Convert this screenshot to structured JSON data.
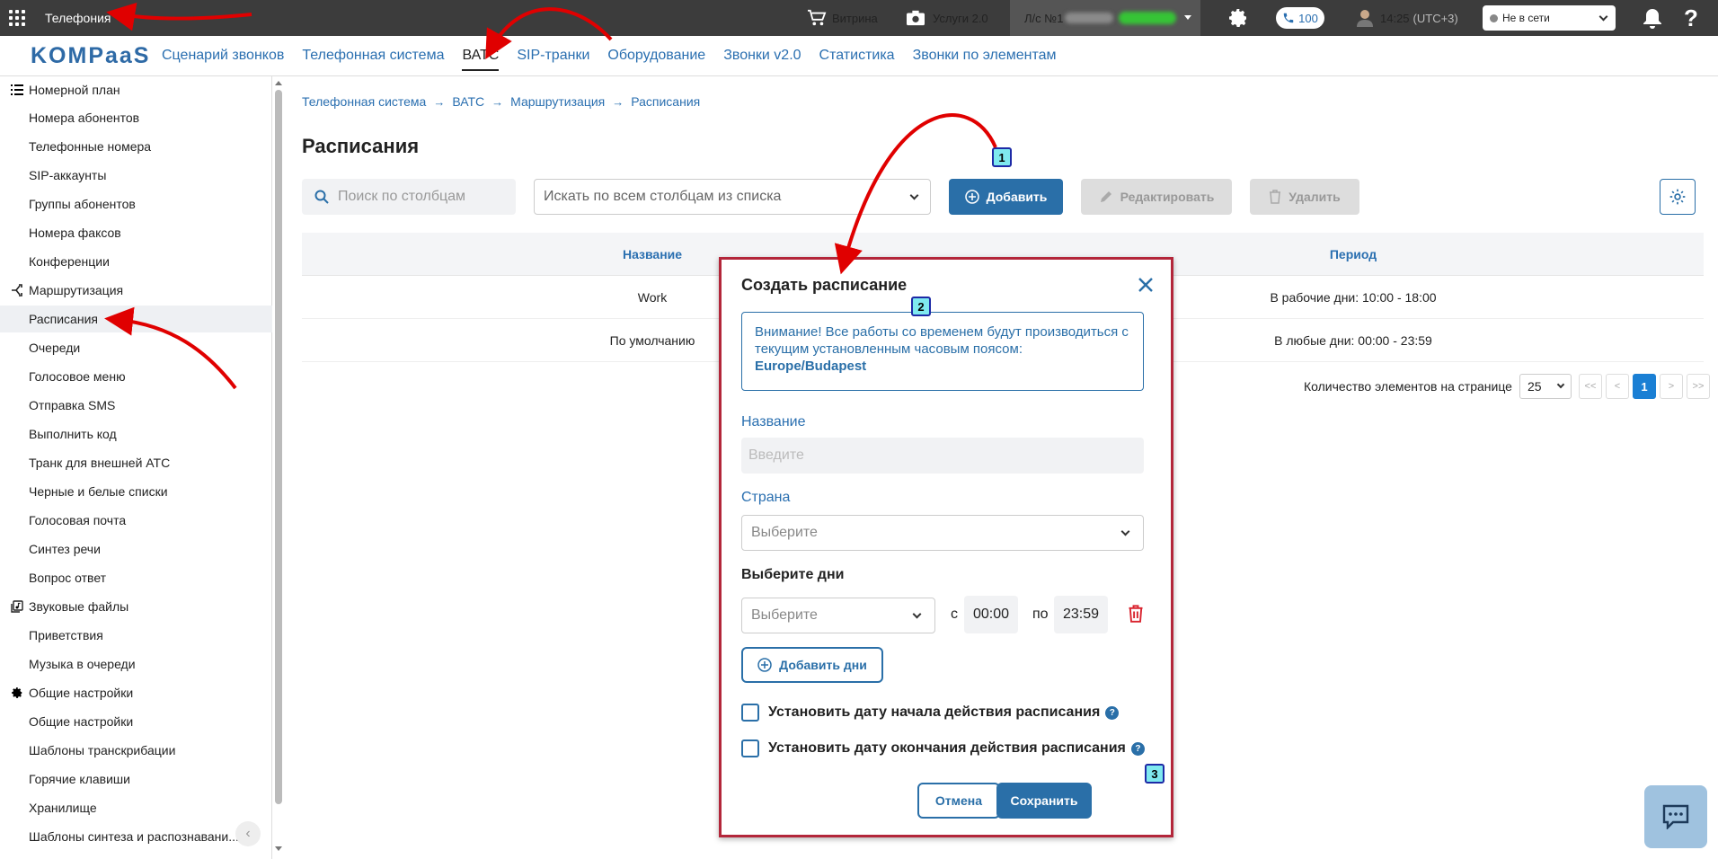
{
  "topbar": {
    "app_title": "Телефония",
    "showcase_label": "Витрина",
    "services_label": "Услуги 2.0",
    "account_label": "Л/с №1",
    "phone_count": "100",
    "time": "14:25",
    "timezone": "(UTC+3)",
    "status": "Не в сети"
  },
  "nav": {
    "logo": "KOMPaaS",
    "items": [
      "Сценарий звонков",
      "Телефонная система",
      "ВАТС",
      "SIP-транки",
      "Оборудование",
      "Звонки v2.0",
      "Статистика",
      "Звонки по элементам"
    ]
  },
  "sidebar": {
    "groups": [
      {
        "label": "Номерной план",
        "items": [
          "Номера абонентов",
          "Телефонные номера",
          "SIP-аккаунты",
          "Группы абонентов",
          "Номера факсов",
          "Конференции"
        ]
      },
      {
        "label": "Маршрутизация",
        "items": [
          "Расписания",
          "Очереди",
          "Голосовое меню",
          "Отправка SMS",
          "Выполнить код",
          "Транк для внешней АТС",
          "Черные и белые списки",
          "Голосовая почта",
          "Синтез речи",
          "Вопрос ответ"
        ]
      },
      {
        "label": "Звуковые файлы",
        "items": [
          "Приветствия",
          "Музыка в очереди"
        ]
      },
      {
        "label": "Общие настройки",
        "items": [
          "Общие настройки",
          "Шаблоны транскрибации",
          "Горячие клавиши",
          "Хранилище",
          "Шаблоны синтеза и распознавани..."
        ]
      }
    ]
  },
  "breadcrumb": [
    "Телефонная система",
    "ВАТС",
    "Маршрутизация",
    "Расписания"
  ],
  "page": {
    "title": "Расписания",
    "search_placeholder": "Поиск по столбцам",
    "column_select": "Искать по всем столбцам из списка",
    "add_label": "Добавить",
    "edit_label": "Редактировать",
    "delete_label": "Удалить"
  },
  "table": {
    "headers": [
      "Название",
      "Период"
    ],
    "rows": [
      [
        "Work",
        "В рабочие дни: 10:00 - 18:00"
      ],
      [
        "По умолчанию",
        "В любые дни: 00:00 - 23:59"
      ]
    ]
  },
  "pager": {
    "label": "Количество элементов на странице",
    "page_size": "25",
    "first": "<<",
    "prev": "<",
    "current": "1",
    "next": ">",
    "last": ">>"
  },
  "modal": {
    "title": "Создать расписание",
    "alert_text": "Внимание! Все работы со временем будут производиться с текущим установленным часовым поясом:",
    "alert_tz": "Europe/Budapest",
    "name_label": "Название",
    "name_placeholder": "Введите",
    "country_label": "Страна",
    "country_placeholder": "Выберите",
    "days_label": "Выберите дни",
    "days_placeholder": "Выберите",
    "from_label": "с",
    "from_time": "00:00",
    "to_label": "по",
    "to_time": "23:59",
    "add_days_label": "Добавить дни",
    "start_date_label": "Установить дату начала действия расписания",
    "end_date_label": "Установить дату окончания действия расписания",
    "help": "?",
    "cancel_label": "Отмена",
    "save_label": "Сохранить"
  },
  "badges": [
    "1",
    "2",
    "3"
  ],
  "colors": {
    "accent": "#2a6fa8",
    "topbar": "#3c3c3c",
    "modal_border": "#b3263a",
    "annotation": "#e00000"
  }
}
